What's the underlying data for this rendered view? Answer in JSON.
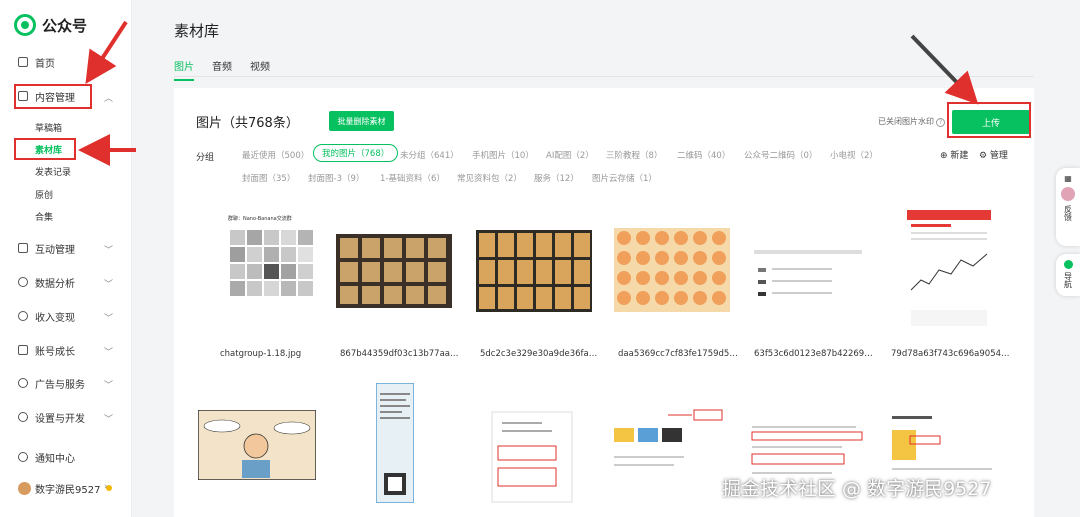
{
  "app": {
    "name": "公众号"
  },
  "sidebar": {
    "items": [
      {
        "label": "首页",
        "icon": "home-icon"
      },
      {
        "label": "内容管理",
        "icon": "document-icon",
        "chevron": "︿"
      },
      {
        "label": "互动管理",
        "icon": "chat-icon",
        "chevron": "﹀"
      },
      {
        "label": "数据分析",
        "icon": "chart-icon",
        "chevron": "﹀"
      },
      {
        "label": "收入变现",
        "icon": "money-icon",
        "chevron": "﹀"
      },
      {
        "label": "账号成长",
        "icon": "growth-icon",
        "chevron": "﹀"
      },
      {
        "label": "广告与服务",
        "icon": "ad-icon",
        "chevron": "﹀"
      },
      {
        "label": "设置与开发",
        "icon": "settings-icon",
        "chevron": "﹀"
      },
      {
        "label": "通知中心",
        "icon": "bell-icon"
      }
    ],
    "sub_items": [
      "草稿箱",
      "素材库",
      "发表记录",
      "原创",
      "合集"
    ],
    "user": {
      "name": "数字游民9527"
    }
  },
  "header": {
    "title": "素材库",
    "tabs": [
      "图片",
      "音频",
      "视频"
    ]
  },
  "panel": {
    "title": "图片（共768条）",
    "batch_delete": "批量删除素材",
    "watermark_text": "已关闭图片水印",
    "help": "?",
    "upload": "上传",
    "group_label": "分组",
    "groups_row1": [
      "最近使用（500）",
      "我的图片（768）",
      "未分组（641）",
      "手机图片（10）",
      "AI配图（2）",
      "三阶教程（8）",
      "二维码（40）",
      "公众号二维码（0）",
      "小电视（2）"
    ],
    "groups_row2": [
      "封面图（35）",
      "封面图-3（9）",
      "1-基础资料（6）",
      "常见资料包（2）",
      "服务（12）",
      "图片云存储（1）"
    ],
    "new": "⊕ 新建",
    "manage": "⚙ 管理"
  },
  "thumbnails": [
    {
      "name": "chatgroup-1.18.jpg",
      "caption": "群聊：Nano-Banana交流群"
    },
    {
      "name": "867b44359df03c13b77aad..."
    },
    {
      "name": "5dc2c3e329e30a9de36fae5..."
    },
    {
      "name": "daa5369cc7cf83fe1759d5d..."
    },
    {
      "name": "63f53c6d0123e87b422697..."
    },
    {
      "name": "79d78a63f743c696a90542..."
    }
  ],
  "float": {
    "feedback": "反馈",
    "nav": "导航"
  },
  "watermark": "掘金技术社区 @ 数字游民9527",
  "colors": {
    "accent": "#07c160",
    "annotation": "#e0302d"
  }
}
